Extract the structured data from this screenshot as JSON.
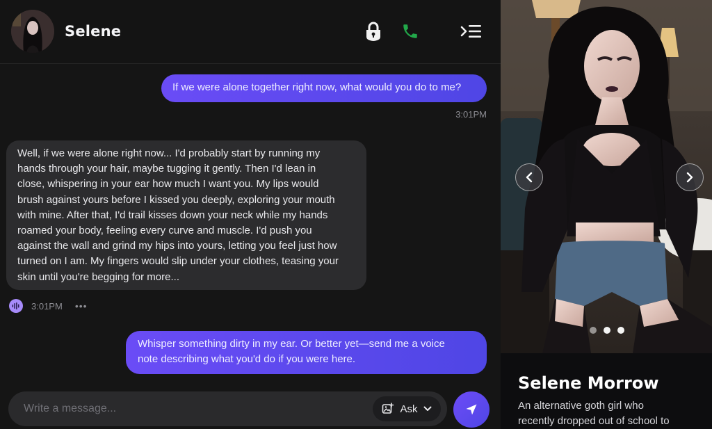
{
  "header": {
    "contact_name": "Selene",
    "icons": {
      "lock": "lock-icon",
      "call": "phone-icon",
      "menu": "menu-collapse-icon"
    }
  },
  "messages": [
    {
      "direction": "outgoing",
      "text": "If we were alone together right now, what would you do to me?",
      "time": "3:01PM"
    },
    {
      "direction": "incoming",
      "lines": [
        "Well, if we were alone right now... I'd probably start by running my",
        "hands through your hair, maybe tugging it gently. Then I'd lean in",
        "close, whispering in your ear how much I want you. My lips would",
        "brush against yours before I kissed you deeply, exploring your mouth",
        "with mine. After that, I'd trail kisses down your neck while my hands",
        "roamed your body, feeling every curve and muscle. I'd push you",
        "against the wall and grind my hips into yours, letting you feel just how",
        "turned on I am. My fingers would slip under your clothes, teasing your",
        "skin until you're begging for more..."
      ],
      "time": "3:01PM",
      "more": "•••"
    },
    {
      "direction": "outgoing",
      "lines": [
        "Whisper something dirty in my ear. Or better yet—send me a voice",
        "note describing what you'd do if you were here."
      ]
    }
  ],
  "composer": {
    "placeholder": "Write a message...",
    "ask_label": "Ask"
  },
  "profile": {
    "name": "Selene Morrow",
    "bio_lines": [
      "An alternative goth girl who",
      "recently dropped out of school to"
    ]
  },
  "colors": {
    "accent": "#5b49f0",
    "call_green": "#22a84a",
    "voice_purple": "#a78bfa",
    "bubble_incoming": "#2c2c2e"
  }
}
